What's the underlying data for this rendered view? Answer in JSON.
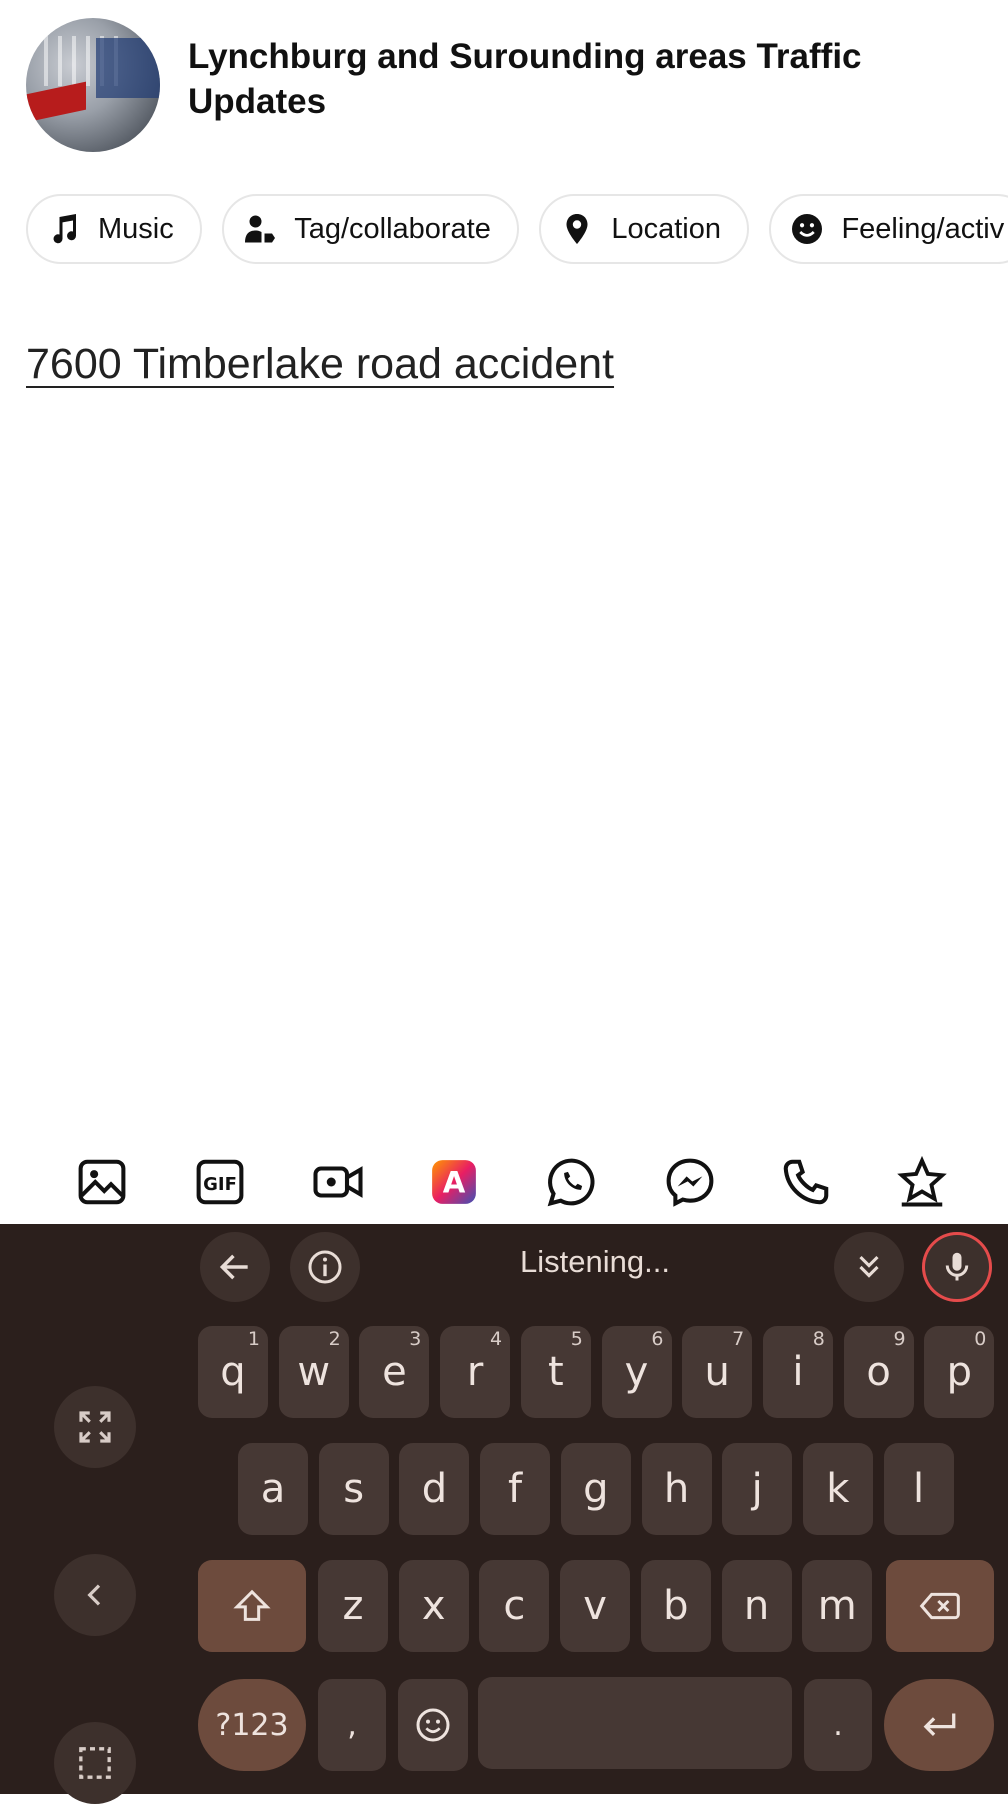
{
  "header": {
    "page_name": "Lynchburg and Surounding areas Traffic Updates"
  },
  "chips": [
    {
      "label": "Music",
      "icon": "music-note-icon"
    },
    {
      "label": "Tag/collaborate",
      "icon": "person-tag-icon"
    },
    {
      "label": "Location",
      "icon": "location-pin-icon"
    },
    {
      "label": "Feeling/activ",
      "icon": "smiley-icon"
    }
  ],
  "post": {
    "text": "7600 Timberlake road accident"
  },
  "toolbar": {
    "icons": [
      "photo-icon",
      "gif-icon",
      "video-icon",
      "text-style-icon",
      "whatsapp-icon",
      "messenger-icon",
      "phone-icon",
      "star-badge-icon"
    ]
  },
  "keyboard": {
    "status": "Listening...",
    "row1": [
      {
        "k": "q",
        "h": "1"
      },
      {
        "k": "w",
        "h": "2"
      },
      {
        "k": "e",
        "h": "3"
      },
      {
        "k": "r",
        "h": "4"
      },
      {
        "k": "t",
        "h": "5"
      },
      {
        "k": "y",
        "h": "6"
      },
      {
        "k": "u",
        "h": "7"
      },
      {
        "k": "i",
        "h": "8"
      },
      {
        "k": "o",
        "h": "9"
      },
      {
        "k": "p",
        "h": "0"
      }
    ],
    "row2": [
      "a",
      "s",
      "d",
      "f",
      "g",
      "h",
      "j",
      "k",
      "l"
    ],
    "row3": [
      "z",
      "x",
      "c",
      "v",
      "b",
      "n",
      "m"
    ],
    "sym_label": "?123",
    "comma": ",",
    "period": ".",
    "colors": {
      "bg": "#2b1f1c",
      "key": "#463834",
      "special": "#6d4b3d"
    }
  }
}
